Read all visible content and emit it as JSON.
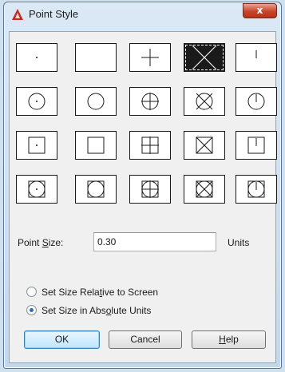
{
  "window": {
    "title": "Point Style",
    "close_glyph": "x",
    "app_icon": "autocad-logo-icon",
    "accent_color": "#c9432b"
  },
  "styles": {
    "columns": [
      "dot",
      "none",
      "plus",
      "cross",
      "tick"
    ],
    "rows": [
      "plain",
      "circle",
      "square",
      "circle-square"
    ],
    "selected": {
      "row": 0,
      "column": 3
    }
  },
  "point_size": {
    "label": "Point Size:",
    "value": "0.30",
    "units": "Units"
  },
  "size_mode": {
    "options": [
      {
        "label": "Set Size Relative to Screen",
        "checked": false
      },
      {
        "label": "Set Size in Absolute Units",
        "checked": true
      }
    ]
  },
  "buttons": {
    "ok": "OK",
    "cancel": "Cancel",
    "help": "Help"
  }
}
